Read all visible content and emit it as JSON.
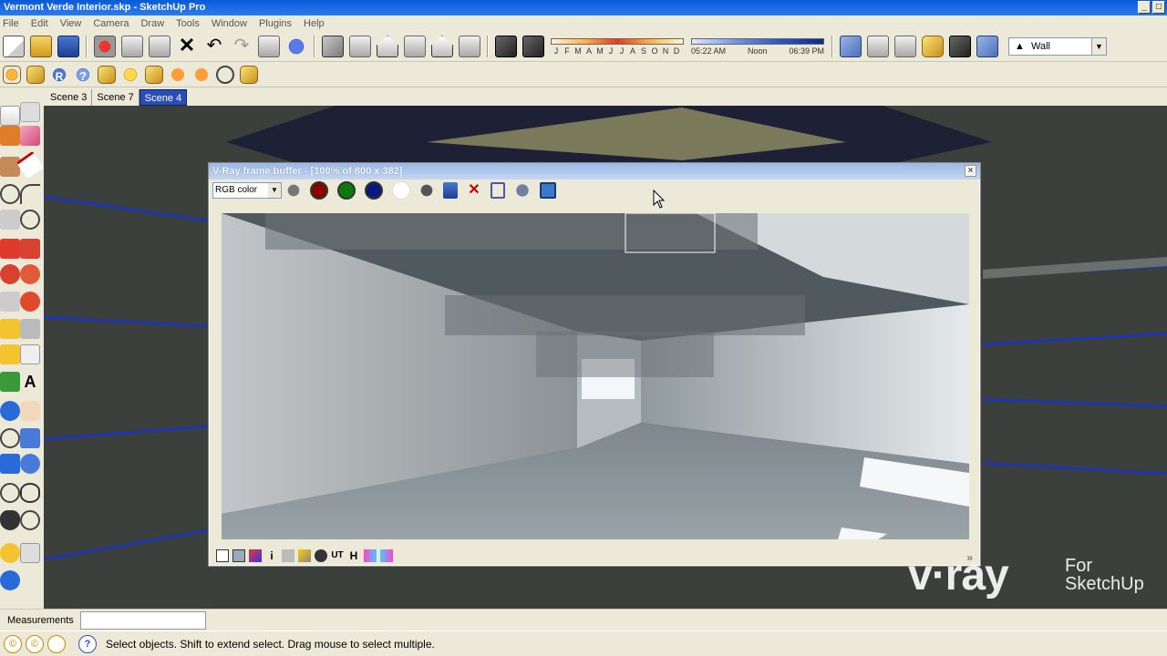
{
  "window": {
    "title": "Vermont Verde Interior.skp - SketchUp Pro",
    "min_label": "_",
    "max_label": "□"
  },
  "menu": [
    "File",
    "Edit",
    "View",
    "Camera",
    "Draw",
    "Tools",
    "Window",
    "Plugins",
    "Help"
  ],
  "toolbar1": {
    "icons": [
      "new-doc-icon",
      "open-folder-icon",
      "save-icon",
      "cut-icon",
      "copy-icon",
      "paste-icon",
      "delete-icon",
      "undo-icon",
      "redo-icon",
      "print-icon",
      "model-info-icon",
      "iso-view-icon",
      "top-view-icon",
      "front-view-icon",
      "right-view-icon",
      "back-view-icon",
      "left-view-icon",
      "shadows-icon",
      "fog-icon"
    ],
    "shadow_months": [
      "J",
      "F",
      "M",
      "A",
      "M",
      "J",
      "J",
      "A",
      "S",
      "O",
      "N",
      "D"
    ],
    "shadow_times": [
      "05:22 AM",
      "Noon",
      "06:39 PM"
    ],
    "style_icons": [
      "xray-icon",
      "wireframe-icon",
      "hidden-line-icon",
      "shaded-icon",
      "textured-icon",
      "monochrome-icon"
    ],
    "layer_value": "Wall"
  },
  "toolbar2": {
    "icons": [
      "vray-material-editor-icon",
      "vray-options-icon",
      "vray-render-icon",
      "vray-help-icon",
      "vray-frame-buffer-icon",
      "omni-light-icon",
      "rect-light-icon",
      "spot-light-icon",
      "ies-light-icon",
      "sphere-light-icon",
      "dome-light-icon"
    ]
  },
  "scenes": [
    {
      "label": "Scene 3",
      "active": false
    },
    {
      "label": "Scene 7",
      "active": false
    },
    {
      "label": "Scene 4",
      "active": true
    }
  ],
  "vray": {
    "title": "V-Ray frame buffer - [100% of 800 x 382]",
    "channel_value": "RGB color",
    "close_label": "×",
    "expand_label": "»",
    "toolbar_icons": [
      "rgb-channel-icon",
      "red-channel-icon",
      "green-channel-icon",
      "blue-channel-icon",
      "alpha-channel-icon",
      "monochrome-icon",
      "save-image-icon",
      "clear-image-icon",
      "track-mouse-icon",
      "render-last-icon",
      "region-render-icon"
    ],
    "bottom_icons": [
      "show-corrections-icon",
      "levels-icon",
      "color-correction-icon",
      "info-icon",
      "pixel-info-icon",
      "lens-effects-icon",
      "stamp-icon",
      "lut-icon",
      "histogram-icon",
      "srgb-icon",
      "compare-icon"
    ]
  },
  "logo": {
    "brand": "v·ray",
    "for": "For",
    "product": "SketchUp"
  },
  "measurements": {
    "label": "Measurements",
    "value": ""
  },
  "status": {
    "message": "Select objects. Shift to extend select. Drag mouse to select multiple.",
    "help_label": "?"
  }
}
